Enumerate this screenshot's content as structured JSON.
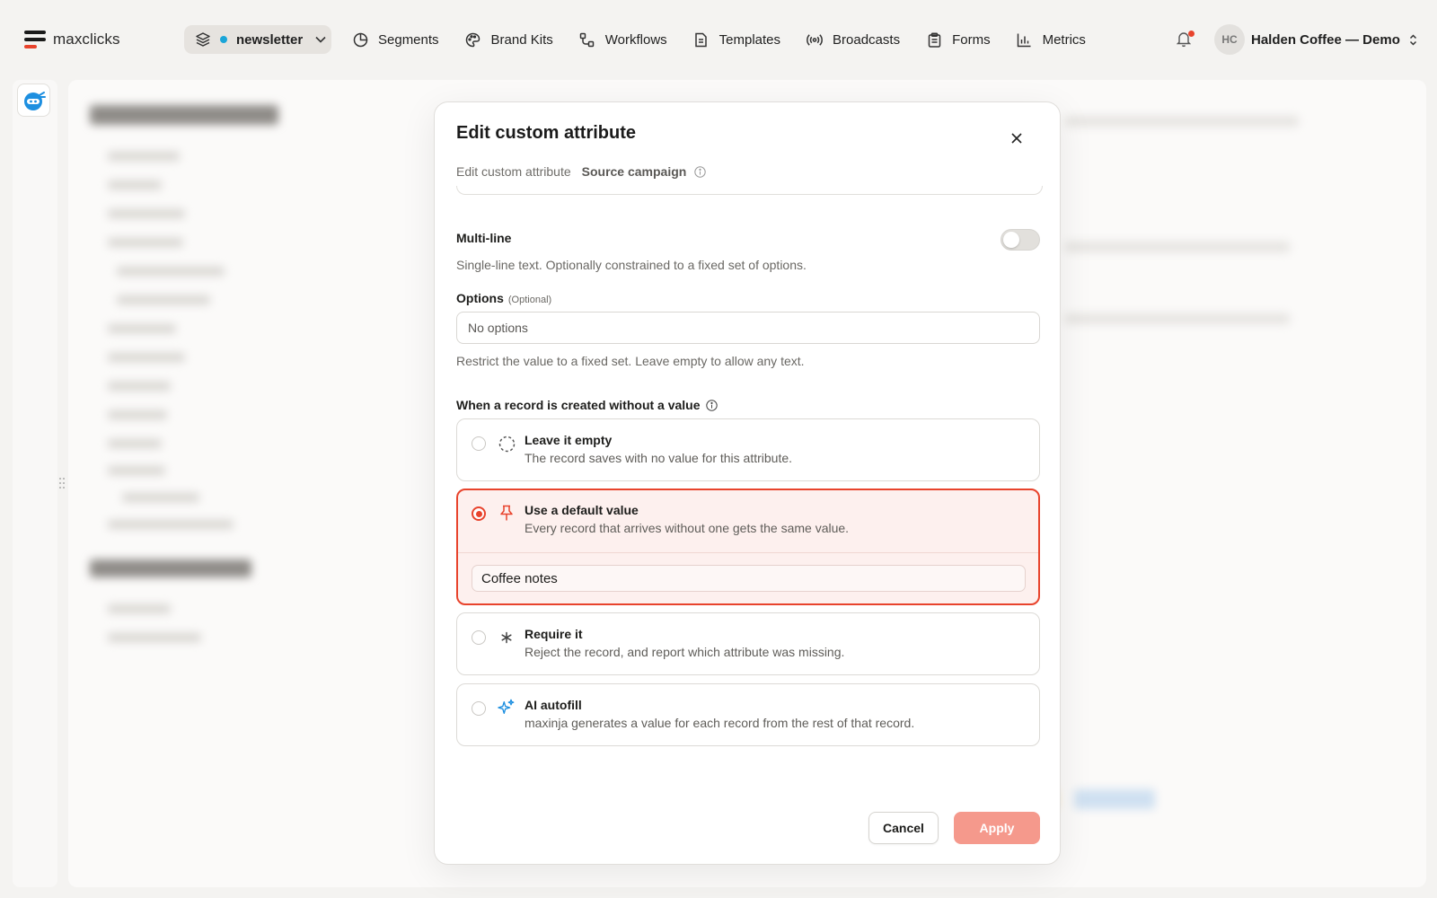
{
  "app": {
    "name": "maxclicks"
  },
  "workspace": {
    "name": "newsletter",
    "dot_color": "#1aa5d8"
  },
  "nav": [
    {
      "label": "Segments",
      "icon": "segments-pie-icon"
    },
    {
      "label": "Brand Kits",
      "icon": "palette-icon"
    },
    {
      "label": "Workflows",
      "icon": "workflow-icon"
    },
    {
      "label": "Templates",
      "icon": "document-icon"
    },
    {
      "label": "Broadcasts",
      "icon": "broadcast-icon"
    },
    {
      "label": "Forms",
      "icon": "clipboard-icon"
    },
    {
      "label": "Metrics",
      "icon": "bar-chart-icon"
    }
  ],
  "account": {
    "initials": "HC",
    "name": "Halden Coffee — Demo"
  },
  "modal": {
    "title": "Edit custom attribute",
    "subtitle_prefix": "Edit custom attribute",
    "attribute_name": "Source campaign",
    "multiline": {
      "label": "Multi-line",
      "help": "Single-line text. Optionally constrained to a fixed set of options.",
      "enabled": false
    },
    "options": {
      "label": "Options",
      "optional_tag": "(Optional)",
      "value": "No options",
      "help": "Restrict the value to a fixed set. Leave empty to allow any text."
    },
    "missing_value": {
      "label": "When a record is created without a value",
      "choices": [
        {
          "title": "Leave it empty",
          "desc": "The record saves with no value for this attribute.",
          "icon": "dashed-circle-icon",
          "selected": false
        },
        {
          "title": "Use a default value",
          "desc": "Every record that arrives without one gets the same value.",
          "icon": "pin-icon",
          "selected": true,
          "default_value": "Coffee notes"
        },
        {
          "title": "Require it",
          "desc": "Reject the record, and report which attribute was missing.",
          "icon": "asterisk-icon",
          "selected": false
        },
        {
          "title": "AI autofill",
          "desc": "maxinja generates a value for each record from the rest of that record.",
          "icon": "sparkle-icon",
          "selected": false
        }
      ]
    },
    "cancel_label": "Cancel",
    "apply_label": "Apply"
  },
  "colors": {
    "accent": "#e8432c",
    "apply_disabled": "#f5998c",
    "selected_bg": "#fdf0ee"
  }
}
